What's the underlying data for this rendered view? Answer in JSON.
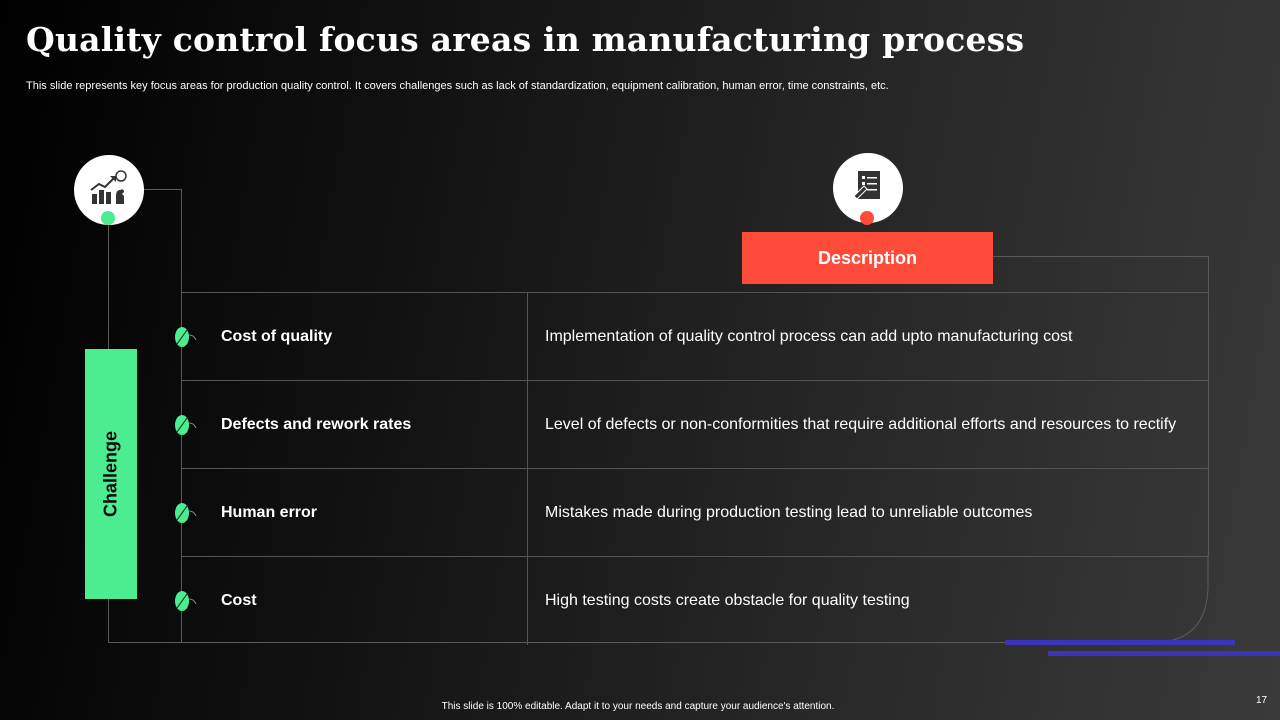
{
  "slide": {
    "title": "Quality control focus areas in manufacturing process",
    "subtitle": "This slide represents key focus areas for production quality control. It covers challenges such as lack of standardization, equipment calibration, human error, time constraints, etc.",
    "description_header": "Description",
    "challenge_label": "Challenge",
    "footer": "This slide is 100% editable. Adapt it to your needs and capture your audience's attention.",
    "page_number": "17"
  },
  "icons": {
    "left": "growth-chart-icon",
    "right": "checklist-document-icon",
    "row_bullet": "leaf-bullet-icon"
  },
  "rows": [
    {
      "name": "Cost of quality",
      "description": "Implementation of quality control process can add upto manufacturing cost"
    },
    {
      "name": "Defects and rework rates",
      "description": "Level of defects or non-conformities that require additional efforts and resources to rectify"
    },
    {
      "name": "Human error",
      "description": "Mistakes made during production testing lead to unreliable outcomes"
    },
    {
      "name": "Cost",
      "description": "High testing costs create obstacle for quality testing"
    }
  ],
  "colors": {
    "accent_green": "#4ced91",
    "accent_red": "#ff4b3a",
    "accent_blue": "#3a35b8",
    "text": "#ffffff"
  }
}
